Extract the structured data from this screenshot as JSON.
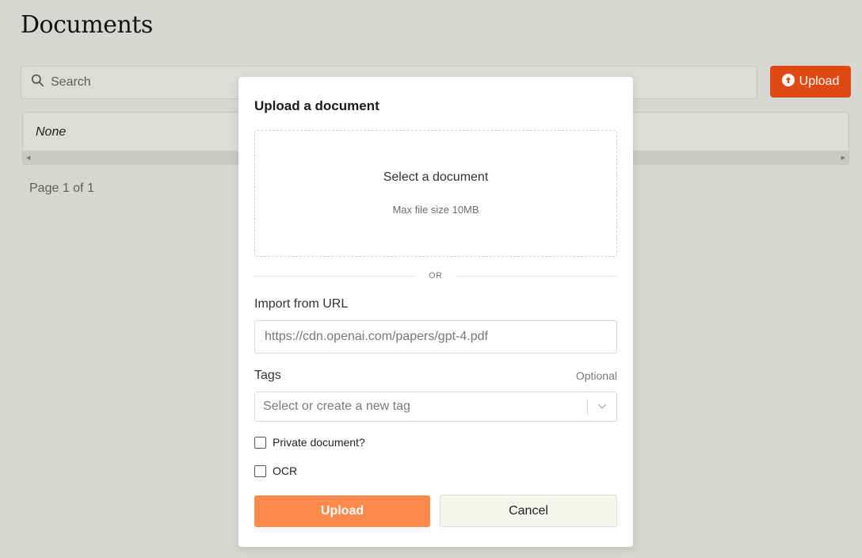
{
  "page": {
    "title": "Documents",
    "search_placeholder": "Search",
    "upload_button": "Upload",
    "table_empty": "None",
    "pagination": "Page 1 of 1"
  },
  "modal": {
    "title": "Upload a document",
    "dropzone_title": "Select a document",
    "dropzone_hint": "Max file size 10MB",
    "divider": "OR",
    "url_label": "Import from URL",
    "url_placeholder": "https://cdn.openai.com/papers/gpt-4.pdf",
    "tags_label": "Tags",
    "tags_optional": "Optional",
    "tags_placeholder": "Select or create a new tag",
    "private_label": "Private document?",
    "private_checked": false,
    "ocr_label": "OCR",
    "ocr_checked": false,
    "submit_label": "Upload",
    "cancel_label": "Cancel"
  },
  "colors": {
    "accent": "#e04a12",
    "submit": "#ff8a4c",
    "backdrop": "#d6d6d2"
  }
}
